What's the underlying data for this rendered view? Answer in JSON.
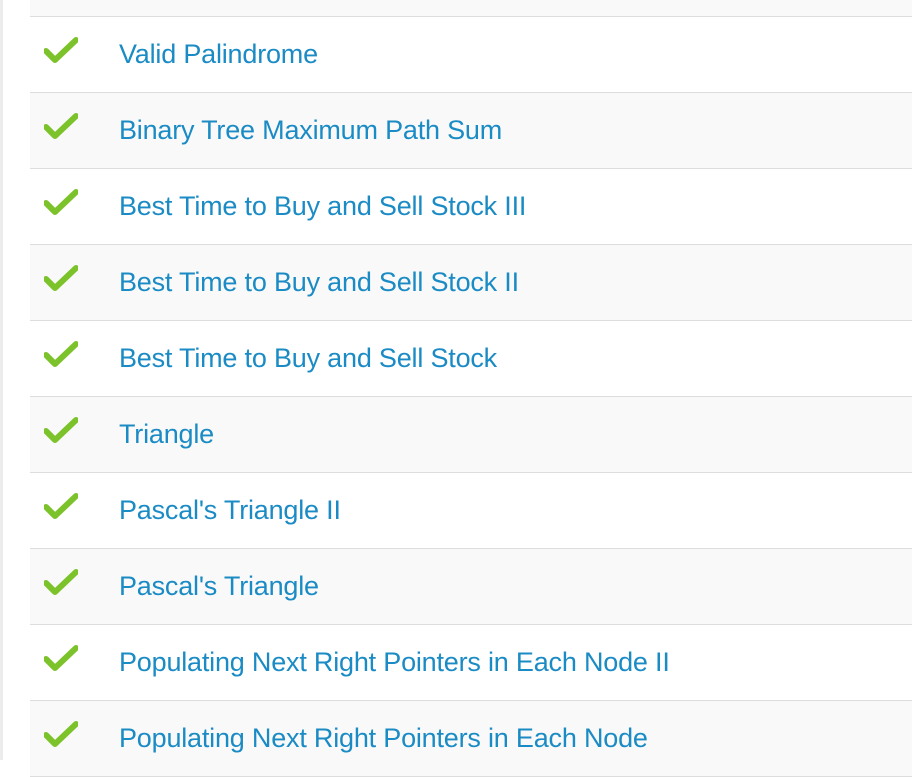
{
  "problems": {
    "items": [
      {
        "title": "Valid Palindrome",
        "status": "accepted",
        "status_icon": "checkmark-icon"
      },
      {
        "title": "Binary Tree Maximum Path Sum",
        "status": "accepted",
        "status_icon": "checkmark-icon"
      },
      {
        "title": "Best Time to Buy and Sell Stock III",
        "status": "accepted",
        "status_icon": "checkmark-icon"
      },
      {
        "title": "Best Time to Buy and Sell Stock II",
        "status": "accepted",
        "status_icon": "checkmark-icon"
      },
      {
        "title": "Best Time to Buy and Sell Stock",
        "status": "accepted",
        "status_icon": "checkmark-icon"
      },
      {
        "title": "Triangle",
        "status": "accepted",
        "status_icon": "checkmark-icon"
      },
      {
        "title": "Pascal's Triangle II",
        "status": "accepted",
        "status_icon": "checkmark-icon"
      },
      {
        "title": "Pascal's Triangle",
        "status": "accepted",
        "status_icon": "checkmark-icon"
      },
      {
        "title": "Populating Next Right Pointers in Each Node II",
        "status": "accepted",
        "status_icon": "checkmark-icon"
      },
      {
        "title": "Populating Next Right Pointers in Each Node",
        "status": "accepted",
        "status_icon": "checkmark-icon"
      }
    ]
  },
  "colors": {
    "link": "#1a8bc4",
    "checkmark_light": "#9bd13a",
    "checkmark_dark": "#5fa61a",
    "row_alt": "#f9f9f9",
    "row_border": "#dddddd"
  }
}
